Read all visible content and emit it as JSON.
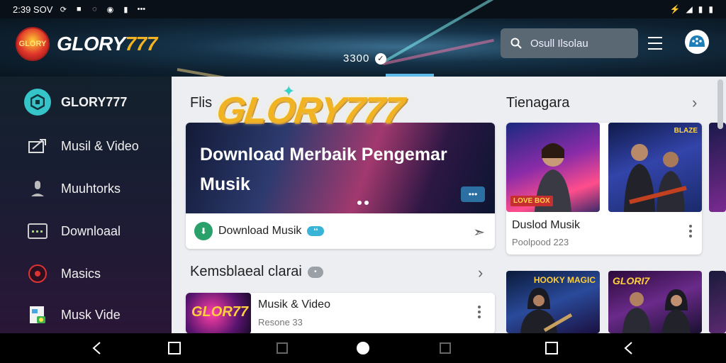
{
  "status_bar": {
    "time": "2:39 SOV",
    "icons_left": [
      "sync-icon",
      "notification-icon",
      "loading-icon",
      "chat-icon",
      "sim-icon",
      "more-dots-icon"
    ],
    "icons_right": [
      "wifi-icon",
      "signal-icon",
      "battery-icon",
      "battery-icon"
    ]
  },
  "header": {
    "logo_badge": "GLORY",
    "logo_word": "GLORY",
    "logo_digits": "777",
    "counter": "3300",
    "search_placeholder": "Osull Ilsolau",
    "colors": {
      "accent": "#35c4c8",
      "brand_gold": "#f2b322",
      "tab_indicator": "#5fb9e8"
    }
  },
  "sidebar": {
    "items": [
      {
        "label": "GLORY777",
        "icon": "app-logo-icon",
        "active": true
      },
      {
        "label": "Musil & Video",
        "icon": "media-icon",
        "active": false
      },
      {
        "label": "Muuhtorks",
        "icon": "user-icon",
        "active": false
      },
      {
        "label": "Downloaal",
        "icon": "download-box-icon",
        "active": false
      },
      {
        "label": "Masics",
        "icon": "music-disc-icon",
        "active": false
      },
      {
        "label": "Musk Vide",
        "icon": "video-file-icon",
        "active": false
      }
    ]
  },
  "main": {
    "overlay_logo": "GLORY777",
    "featured": {
      "section_title": "Flis",
      "hero_title": "Download Merbaik Pengemar Musik",
      "hero_chip": "•••",
      "footer_label": "Download Musik",
      "footer_badge": "❛❛"
    },
    "recommended": {
      "section_title": "Kemsblaeal clarai",
      "section_badge": "•",
      "item": {
        "title": "Musik & Video",
        "subtitle": "Resone 33",
        "thumb_label": "GLOR77"
      }
    },
    "trending": {
      "section_title": "Tienagara",
      "cards": [
        {
          "title": "Duslod Musik",
          "subtitle": "Poolpood 223",
          "tag": "LOVE BOX"
        },
        {
          "tag": "BLAZE"
        }
      ],
      "bottom_cards": [
        {
          "tag": "HOOKY MAGIC"
        },
        {
          "tag": "GLORI7"
        }
      ]
    }
  },
  "nav_bar": {
    "buttons": [
      "back",
      "recents",
      "home-small",
      "home",
      "recents-small",
      "recents",
      "back"
    ]
  }
}
